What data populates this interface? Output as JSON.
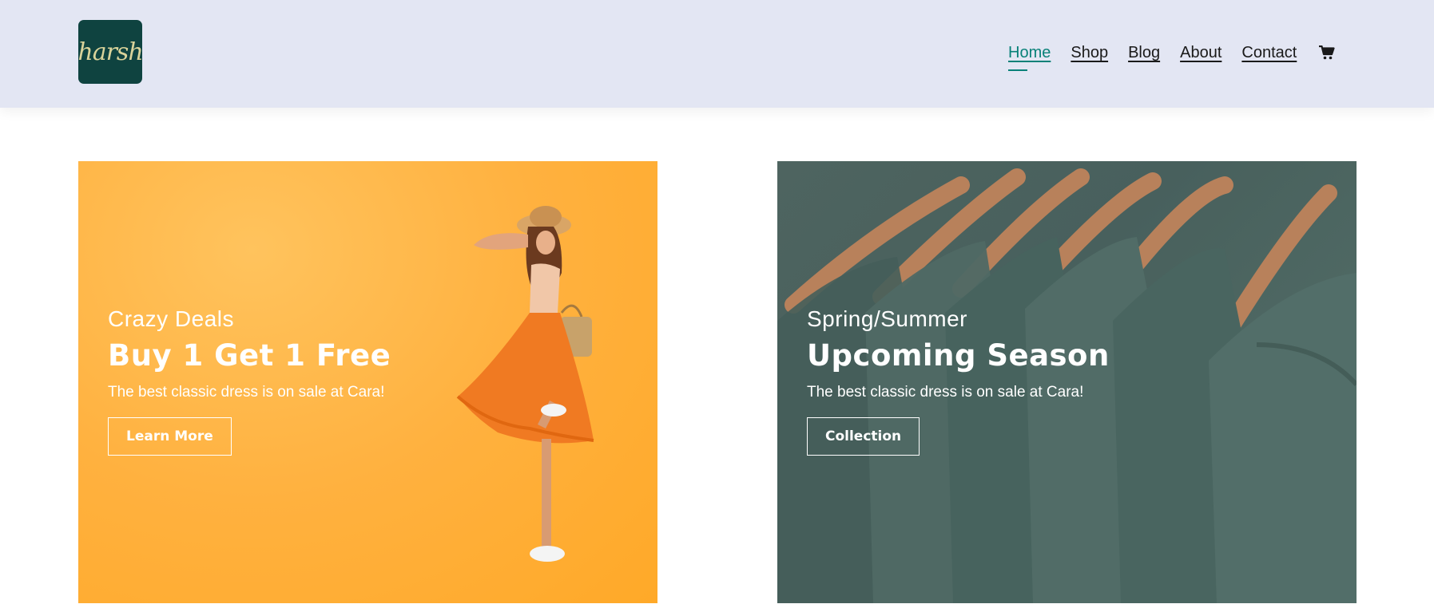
{
  "header": {
    "logo_text": "harsh",
    "nav": [
      {
        "label": "Home",
        "active": true
      },
      {
        "label": "Shop",
        "active": false
      },
      {
        "label": "Blog",
        "active": false
      },
      {
        "label": "About",
        "active": false
      },
      {
        "label": "Contact",
        "active": false
      }
    ],
    "cart_icon": "cart-icon"
  },
  "banners": [
    {
      "subtitle": "Crazy Deals",
      "title": "Buy 1 Get 1 Free",
      "text": "The best classic dress is on sale at Cara!",
      "button": "Learn More"
    },
    {
      "subtitle": "Spring/Summer",
      "title": "Upcoming Season",
      "text": "The best classic dress is on sale at Cara!",
      "button": "Collection"
    }
  ],
  "colors": {
    "header_bg": "#e3e6f3",
    "accent": "#088178",
    "logo_bg": "#0f4340",
    "banner_left_bg": "#ffb13f",
    "banner_right_bg": "#556d69"
  }
}
